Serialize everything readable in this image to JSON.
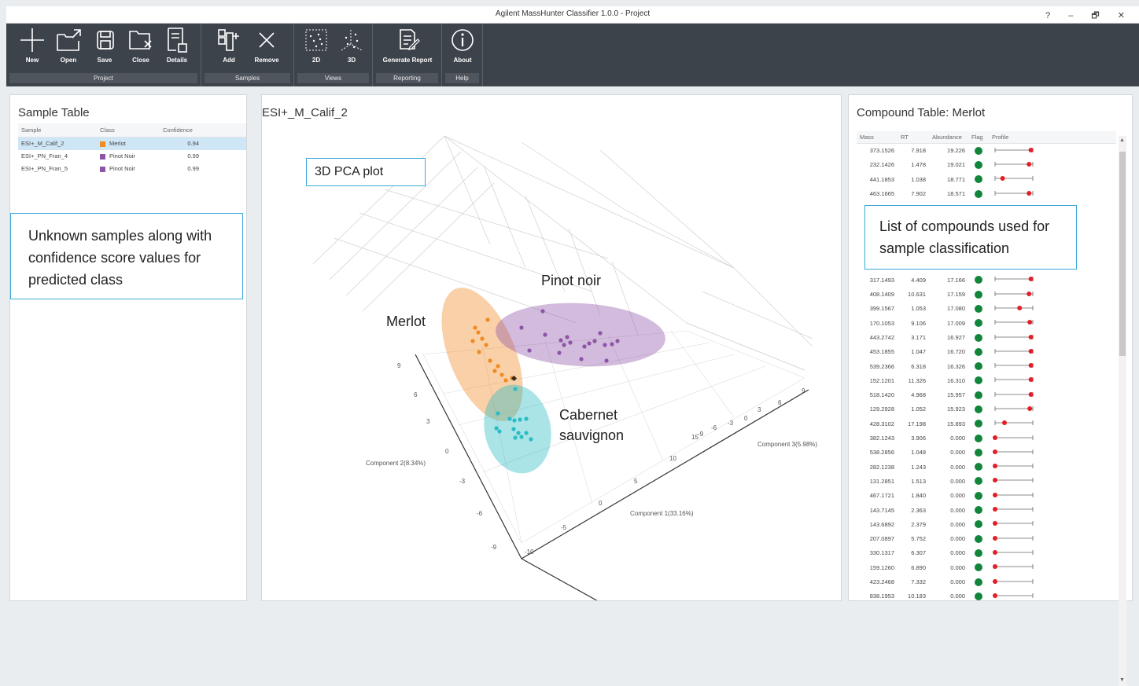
{
  "window": {
    "title": "Agilent MassHunter Classifier 1.0.0 - Project",
    "controls": [
      "?",
      "–",
      "🗗",
      "✕"
    ]
  },
  "ribbon": {
    "groups": [
      {
        "name": "Project",
        "buttons": [
          "New",
          "Open",
          "Save",
          "Close",
          "Details"
        ]
      },
      {
        "name": "Samples",
        "buttons": [
          "Add",
          "Remove"
        ]
      },
      {
        "name": "Views",
        "buttons": [
          "2D",
          "3D"
        ]
      },
      {
        "name": "Reporting",
        "buttons": [
          "Generate Report"
        ]
      },
      {
        "name": "Help",
        "buttons": [
          "About"
        ]
      }
    ]
  },
  "sample_table": {
    "title": "Sample Table",
    "headers": [
      "Sample",
      "Class",
      "Confidence"
    ],
    "rows": [
      {
        "sample": "ESI+_M_Calif_2",
        "class": "Merlot",
        "color": "#f08a24",
        "confidence": "0.94"
      },
      {
        "sample": "ESI+_PN_Fran_4",
        "class": "Pinot Noir",
        "color": "#8e54a8",
        "confidence": "0.99"
      },
      {
        "sample": "ESI+_PN_Fran_5",
        "class": "Pinot Noir",
        "color": "#8e54a8",
        "confidence": "0.99"
      }
    ],
    "callout": "Unknown samples along with confidence score values for predicted class"
  },
  "plot": {
    "title": "ESI+_M_Calif_2",
    "callout": "3D PCA plot",
    "labels": {
      "pinot": "Pinot noir",
      "merlot": "Merlot",
      "cabernet_line1": "Cabernet",
      "cabernet_line2": "sauvignon"
    },
    "axes": {
      "x": "Component 1(33.16%)",
      "y": "Component 2(8.34%)",
      "z": "Component 3(5.98%)"
    },
    "ticks_y": [
      "9",
      "6",
      "3",
      "0",
      "-3",
      "-6",
      "-9"
    ],
    "ticks_x": [
      "-10",
      "-5",
      "0",
      "5",
      "10"
    ],
    "ticks_z": [
      "9",
      "6",
      "3",
      "0",
      "-3",
      "-6",
      "-9",
      "15"
    ],
    "colors": {
      "merlot": "#f08a24",
      "pinot": "#8e54a8",
      "cabernet": "#2bbcc4"
    }
  },
  "compound_table": {
    "title": "Compound Table: Merlot",
    "headers": [
      "Mass",
      "RT",
      "Abundance",
      "Flag",
      "Profile"
    ],
    "callout": "List of compounds used for sample classification",
    "rows": [
      {
        "mass": "373.1526",
        "rt": "7.918",
        "abundance": "19.226",
        "p": 0.95
      },
      {
        "mass": "232.1426",
        "rt": "1.478",
        "abundance": "19.021",
        "p": 0.9
      },
      {
        "mass": "441.1853",
        "rt": "1.038",
        "abundance": "18.771",
        "p": 0.2
      },
      {
        "mass": "463.1665",
        "rt": "7.902",
        "abundance": "18.571",
        "p": 0.9
      },
      {
        "mass": "",
        "rt": "",
        "abundance": "",
        "p": null
      },
      {
        "mass": "",
        "rt": "",
        "abundance": "",
        "p": null
      },
      {
        "mass": "",
        "rt": "",
        "abundance": "",
        "p": null
      },
      {
        "mass": "",
        "rt": "",
        "abundance": "",
        "p": null
      },
      {
        "mass": "",
        "rt": "",
        "abundance": "",
        "p": null
      },
      {
        "mass": "317.1493",
        "rt": "4.409",
        "abundance": "17.166",
        "p": 0.95
      },
      {
        "mass": "408.1409",
        "rt": "10.631",
        "abundance": "17.159",
        "p": 0.9
      },
      {
        "mass": "399.1567",
        "rt": "1.053",
        "abundance": "17.080",
        "p": 0.65
      },
      {
        "mass": "170.1053",
        "rt": "9.106",
        "abundance": "17.009",
        "p": 0.92
      },
      {
        "mass": "443.2742",
        "rt": "3.171",
        "abundance": "16.927",
        "p": 0.95
      },
      {
        "mass": "453.1855",
        "rt": "1.047",
        "abundance": "16.720",
        "p": 0.95
      },
      {
        "mass": "539.2366",
        "rt": "6.318",
        "abundance": "16.326",
        "p": 0.95
      },
      {
        "mass": "152.1201",
        "rt": "11.326",
        "abundance": "16.310",
        "p": 0.95
      },
      {
        "mass": "518.1420",
        "rt": "4.968",
        "abundance": "15.957",
        "p": 0.95
      },
      {
        "mass": "129.2928",
        "rt": "1.052",
        "abundance": "15.923",
        "p": 0.92
      },
      {
        "mass": "428.3102",
        "rt": "17.198",
        "abundance": "15.893",
        "p": 0.25
      },
      {
        "mass": "382.1243",
        "rt": "3.906",
        "abundance": "0.000",
        "p": 0.0
      },
      {
        "mass": "538.2856",
        "rt": "1.048",
        "abundance": "0.000",
        "p": 0.0
      },
      {
        "mass": "282.1238",
        "rt": "1.243",
        "abundance": "0.000",
        "p": 0.0
      },
      {
        "mass": "131.2851",
        "rt": "1.513",
        "abundance": "0.000",
        "p": 0.0
      },
      {
        "mass": "467.1721",
        "rt": "1.840",
        "abundance": "0.000",
        "p": 0.0
      },
      {
        "mass": "143.7145",
        "rt": "2.363",
        "abundance": "0.000",
        "p": 0.0
      },
      {
        "mass": "143.6892",
        "rt": "2.379",
        "abundance": "0.000",
        "p": 0.0
      },
      {
        "mass": "207.0897",
        "rt": "5.752",
        "abundance": "0.000",
        "p": 0.0
      },
      {
        "mass": "330.1317",
        "rt": "6.307",
        "abundance": "0.000",
        "p": 0.0
      },
      {
        "mass": "159.1260",
        "rt": "6.890",
        "abundance": "0.000",
        "p": 0.0
      },
      {
        "mass": "423.2468",
        "rt": "7.332",
        "abundance": "0.000",
        "p": 0.0
      },
      {
        "mass": "838.1953",
        "rt": "10.183",
        "abundance": "0.000",
        "p": 0.0
      }
    ]
  }
}
